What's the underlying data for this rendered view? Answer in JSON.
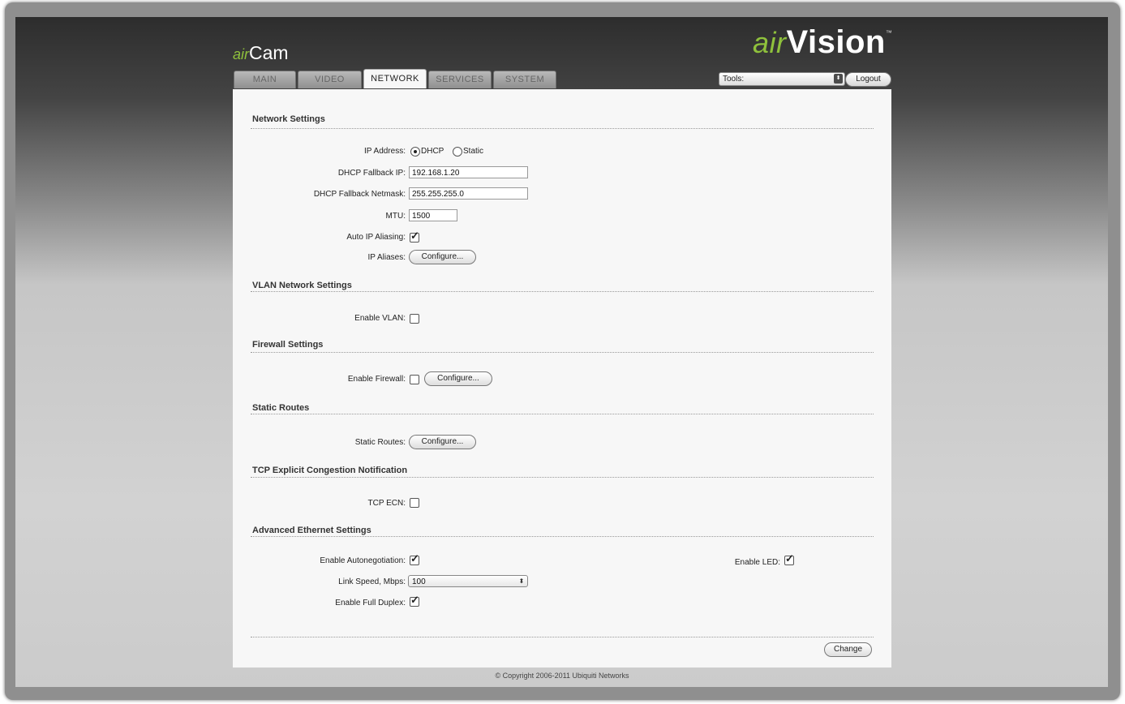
{
  "header": {
    "left_logo_prefix": "air",
    "left_logo_name": "Cam",
    "right_logo_prefix": "air",
    "right_logo_name": "Vision",
    "right_logo_tm": "™"
  },
  "tabs": [
    {
      "label": "MAIN"
    },
    {
      "label": "VIDEO"
    },
    {
      "label": "NETWORK"
    },
    {
      "label": "SERVICES"
    },
    {
      "label": "SYSTEM"
    }
  ],
  "tools": {
    "selected": "Tools:",
    "arrow": "⬍"
  },
  "logout_label": "Logout",
  "network": {
    "title": "Network Settings",
    "ip_address_label": "IP Address:",
    "dhcp_label": "DHCP",
    "static_label": "Static",
    "fallback_ip_label": "DHCP Fallback IP:",
    "fallback_ip_value": "192.168.1.20",
    "fallback_netmask_label": "DHCP Fallback Netmask:",
    "fallback_netmask_value": "255.255.255.0",
    "mtu_label": "MTU:",
    "mtu_value": "1500",
    "auto_ip_aliasing_label": "Auto IP Aliasing:",
    "ip_aliases_label": "IP Aliases:",
    "configure_label": "Configure..."
  },
  "vlan": {
    "title": "VLAN Network Settings",
    "enable_vlan_label": "Enable VLAN:"
  },
  "firewall": {
    "title": "Firewall Settings",
    "enable_firewall_label": "Enable Firewall:",
    "configure_label": "Configure..."
  },
  "static_routes": {
    "title": "Static Routes",
    "label": "Static Routes:",
    "configure_label": "Configure..."
  },
  "tcp": {
    "title": "TCP Explicit Congestion Notification",
    "tcp_ecn_label": "TCP ECN:"
  },
  "ethernet": {
    "title": "Advanced Ethernet Settings",
    "autoneg_label": "Enable Autonegotiation:",
    "link_speed_label": "Link Speed, Mbps:",
    "link_speed_value": "100",
    "full_duplex_label": "Enable Full Duplex:",
    "enable_led_label": "Enable LED:"
  },
  "change_label": "Change",
  "footer": "© Copyright 2006-2011 Ubiquiti Networks"
}
